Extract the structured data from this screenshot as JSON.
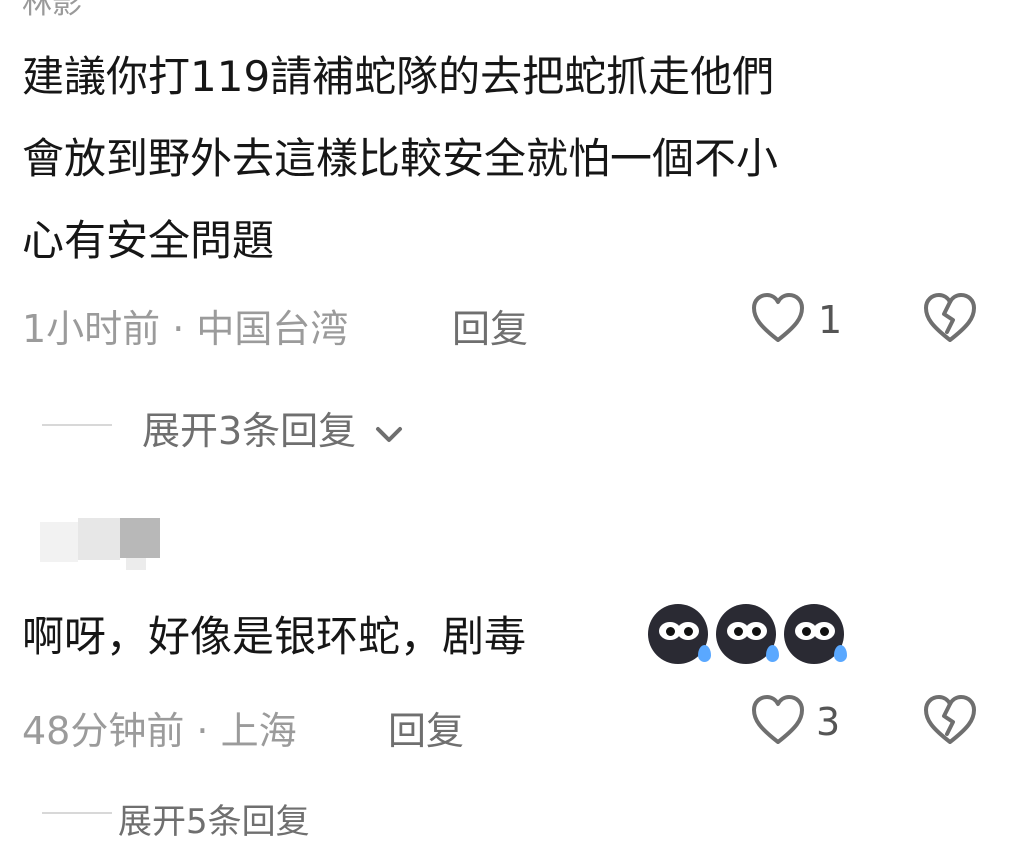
{
  "top_cut_text": "林影",
  "comment1": {
    "lines": [
      "建議你打119請補蛇隊的去把蛇抓走他們",
      "會放到野外去這樣比較安全就怕一個不小",
      "心有安全問題"
    ],
    "meta": "1小时前 · 中国台湾",
    "reply_label": "回复",
    "like_count": "1",
    "expand_label": "展开3条回复"
  },
  "comment2": {
    "text": "啊呀，好像是银环蛇，剧毒",
    "emoji_names": [
      "cold-sweat-emoji",
      "cold-sweat-emoji",
      "cold-sweat-emoji"
    ],
    "meta": "48分钟前 · 上海",
    "reply_label": "回复",
    "like_count": "3",
    "expand_label": "展开5条回复"
  },
  "colors": {
    "text": "#161616",
    "meta": "#9b9b9b",
    "accent_drop": "#5aa8ff"
  }
}
